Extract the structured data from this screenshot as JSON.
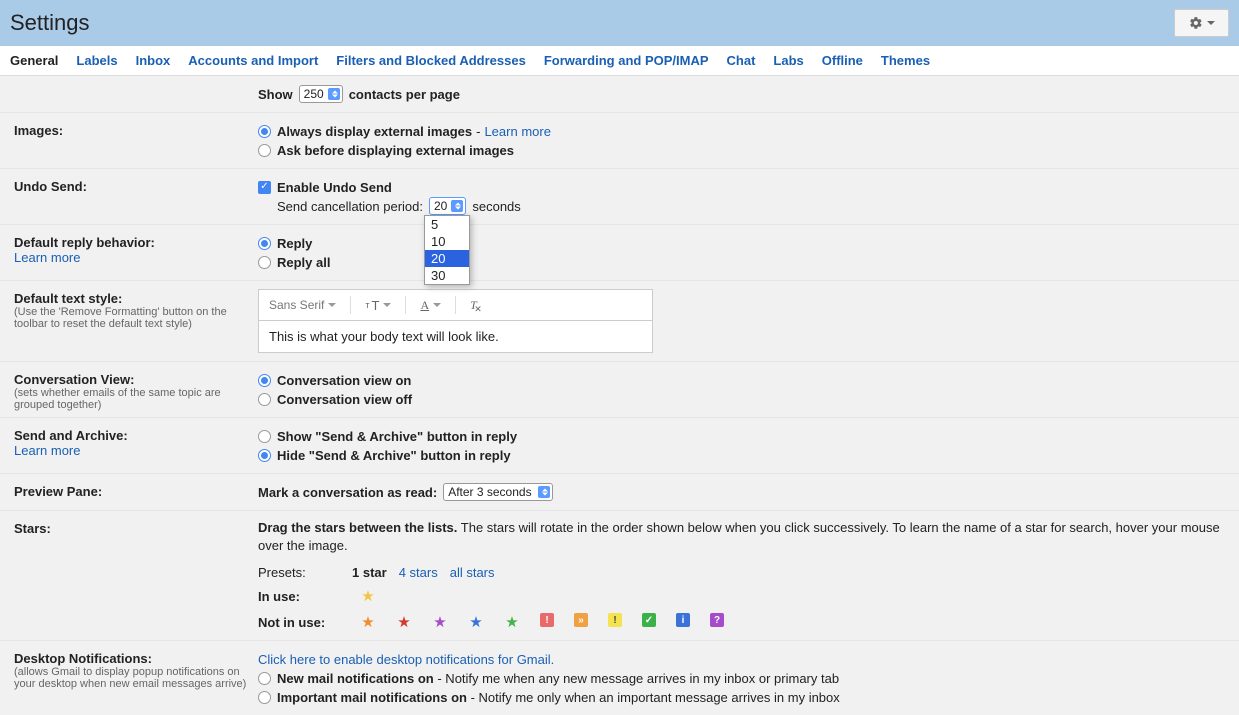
{
  "header": {
    "title": "Settings"
  },
  "tabs": [
    "General",
    "Labels",
    "Inbox",
    "Accounts and Import",
    "Filters and Blocked Addresses",
    "Forwarding and POP/IMAP",
    "Chat",
    "Labs",
    "Offline",
    "Themes"
  ],
  "contacts": {
    "show_label": "Show",
    "value": "250",
    "suffix": "contacts per page"
  },
  "images": {
    "title": "Images:",
    "opt1": "Always display external images",
    "learn": "Learn more",
    "opt2": "Ask before displaying external images"
  },
  "undo": {
    "title": "Undo Send:",
    "enable": "Enable Undo Send",
    "period_label": "Send cancellation period:",
    "period_value": "20",
    "period_suffix": "seconds",
    "options": [
      "5",
      "10",
      "20",
      "30"
    ]
  },
  "reply": {
    "title": "Default reply behavior:",
    "learn": "Learn more",
    "opt1": "Reply",
    "opt2": "Reply all"
  },
  "textstyle": {
    "title": "Default text style:",
    "sub": "(Use the 'Remove Formatting' button on the toolbar to reset the default text style)",
    "font": "Sans Serif",
    "preview": "This is what your body text will look like."
  },
  "conversation": {
    "title": "Conversation View:",
    "sub": "(sets whether emails of the same topic are grouped together)",
    "opt1": "Conversation view on",
    "opt2": "Conversation view off"
  },
  "sendarchive": {
    "title": "Send and Archive:",
    "learn": "Learn more",
    "opt1": "Show \"Send & Archive\" button in reply",
    "opt2": "Hide \"Send & Archive\" button in reply"
  },
  "preview": {
    "title": "Preview Pane:",
    "label": "Mark a conversation as read:",
    "value": "After 3 seconds"
  },
  "stars": {
    "title": "Stars:",
    "drag_bold": "Drag the stars between the lists.",
    "drag_rest": "  The stars will rotate in the order shown below when you click successively. To learn the name of a star for search, hover your mouse over the image.",
    "presets_label": "Presets:",
    "p1": "1 star",
    "p4": "4 stars",
    "pall": "all stars",
    "in_use": "In use:",
    "not_in_use": "Not in use:"
  },
  "desktop": {
    "title": "Desktop Notifications:",
    "sub": "(allows Gmail to display popup notifications on your desktop when new email messages arrive)",
    "click": "Click here to enable desktop notifications for Gmail.",
    "opt1_bold": "New mail notifications on",
    "opt1_rest": " - Notify me when any new message arrives in my inbox or primary tab",
    "opt2_bold": "Important mail notifications on",
    "opt2_rest": " - Notify me only when an important message arrives in my inbox"
  }
}
